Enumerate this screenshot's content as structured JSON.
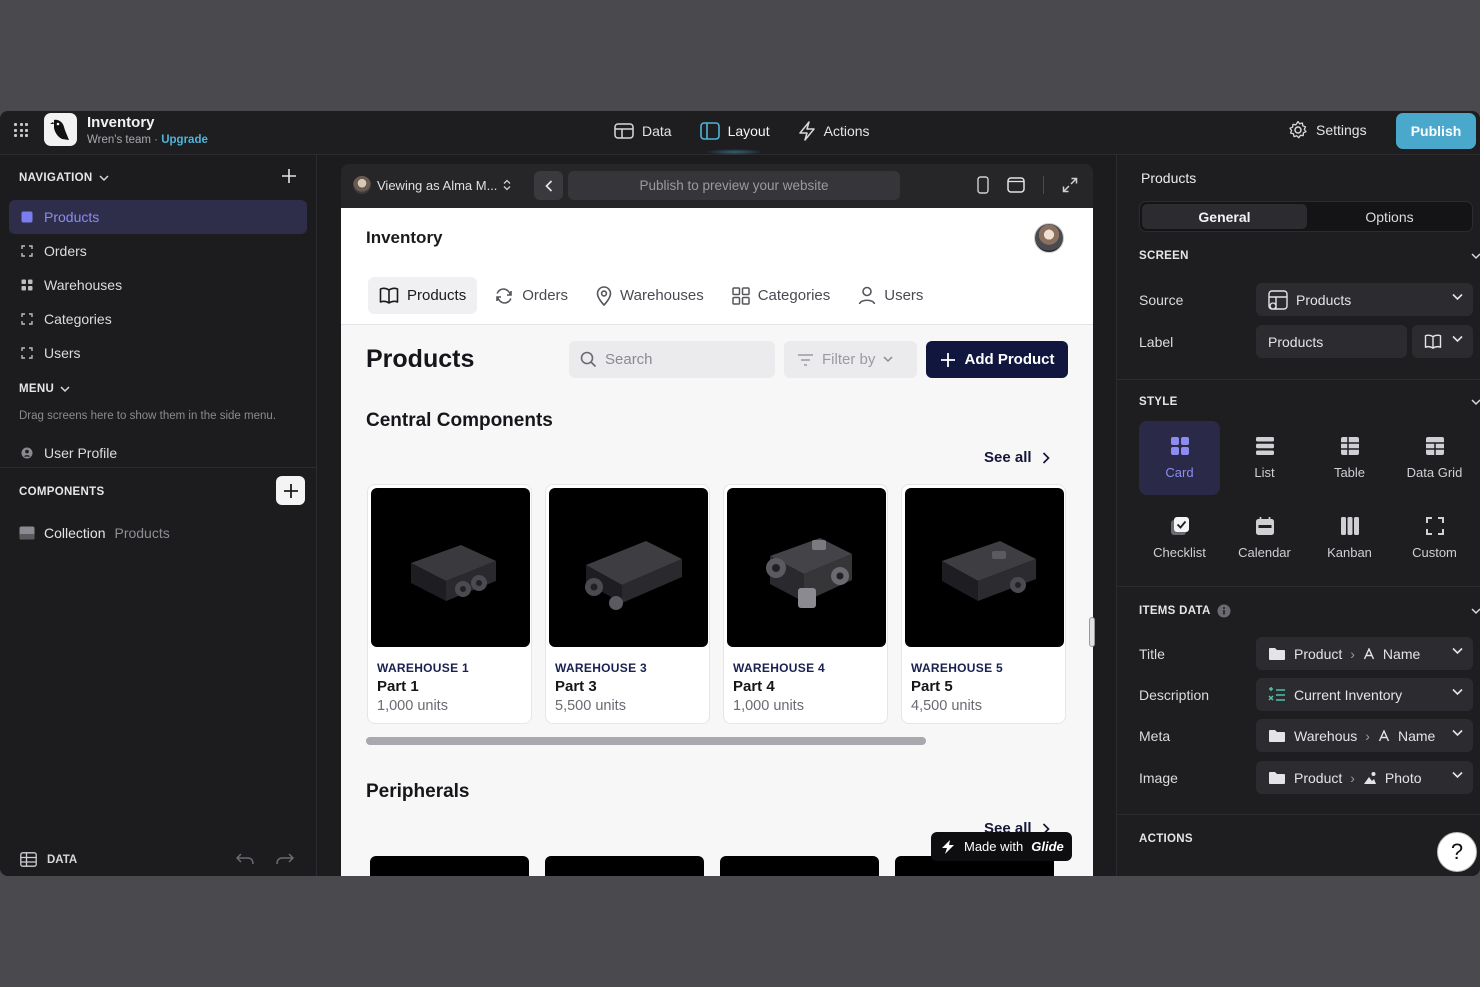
{
  "topbar": {
    "app_title": "Inventory",
    "team": "Wren's team",
    "separator": " · ",
    "upgrade": "Upgrade",
    "tabs": [
      {
        "label": "Data",
        "icon": "table-icon"
      },
      {
        "label": "Layout",
        "icon": "layout-icon"
      },
      {
        "label": "Actions",
        "icon": "bolt-icon"
      }
    ],
    "settings_label": "Settings",
    "publish_label": "Publish",
    "accent": "#4aa8cc"
  },
  "left": {
    "navigation_header": "NAVIGATION",
    "nav_items": [
      {
        "label": "Products",
        "active": true
      },
      {
        "label": "Orders"
      },
      {
        "label": "Warehouses"
      },
      {
        "label": "Categories"
      },
      {
        "label": "Users"
      }
    ],
    "menu_header": "MENU",
    "menu_hint": "Drag screens here to show them in the side menu.",
    "menu_items": [
      {
        "label": "User Profile"
      }
    ],
    "components_header": "COMPONENTS",
    "component": {
      "label": "Collection",
      "sub": "Products"
    },
    "footer_label": "DATA"
  },
  "preview": {
    "viewing_as": "Viewing as Alma M...",
    "url_placeholder": "Publish to preview your website",
    "site_title": "Inventory",
    "tabs": [
      {
        "label": "Products",
        "active": true
      },
      {
        "label": "Orders"
      },
      {
        "label": "Warehouses"
      },
      {
        "label": "Categories"
      },
      {
        "label": "Users"
      }
    ],
    "page_title": "Products",
    "search_placeholder": "Search",
    "filter_label": "Filter by",
    "add_button": "Add Product",
    "sections": [
      {
        "title": "Central Components",
        "see_all": "See all",
        "cards": [
          {
            "warehouse": "WAREHOUSE 1",
            "part": "Part 1",
            "units": "1,000 units"
          },
          {
            "warehouse": "WAREHOUSE 3",
            "part": "Part 3",
            "units": "5,500 units"
          },
          {
            "warehouse": "WAREHOUSE 4",
            "part": "Part 4",
            "units": "1,000 units"
          },
          {
            "warehouse": "WAREHOUSE 5",
            "part": "Part 5",
            "units": "4,500 units"
          }
        ]
      },
      {
        "title": "Peripherals",
        "see_all": "See all"
      }
    ],
    "made_with": "Made with",
    "glide": "Glide"
  },
  "right": {
    "title": "Products",
    "seg_tabs": [
      "General",
      "Options"
    ],
    "screen_header": "SCREEN",
    "source_label": "Source",
    "source_value": "Products",
    "label_label": "Label",
    "label_value": "Products",
    "style_header": "STYLE",
    "styles": [
      {
        "label": "Card",
        "active": true
      },
      {
        "label": "List"
      },
      {
        "label": "Table"
      },
      {
        "label": "Data Grid"
      },
      {
        "label": "Checklist"
      },
      {
        "label": "Calendar"
      },
      {
        "label": "Kanban"
      },
      {
        "label": "Custom"
      }
    ],
    "items_header": "ITEMS DATA",
    "fields": [
      {
        "label": "Title",
        "table": "Product",
        "col": "Name"
      },
      {
        "label": "Description",
        "value": "Current Inventory"
      },
      {
        "label": "Meta",
        "table": "Warehous",
        "col": "Name"
      },
      {
        "label": "Image",
        "table": "Product",
        "col": "Photo"
      }
    ],
    "actions_header": "ACTIONS",
    "help": "?"
  }
}
